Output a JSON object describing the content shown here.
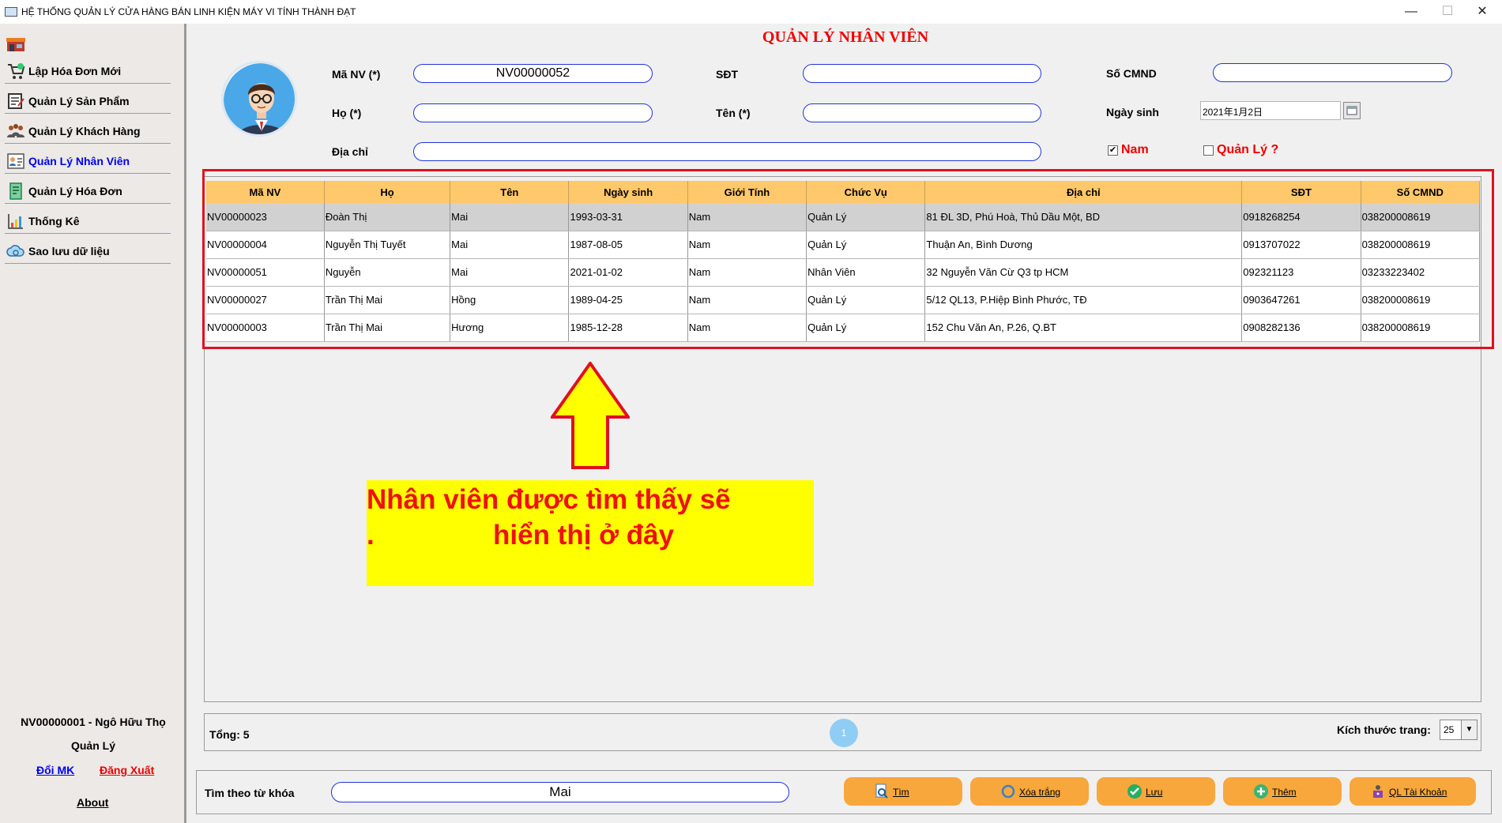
{
  "window": {
    "title": "HỆ THỐNG QUẢN LÝ CỬA HÀNG BÁN LINH KIỆN MÁY VI TÍNH THÀNH ĐẠT",
    "min": "—",
    "max": "☐",
    "close": "✕"
  },
  "sidebar": {
    "items": [
      {
        "label": "Lập Hóa Đơn Mới",
        "icon": "cart-icon"
      },
      {
        "label": "Quản Lý Sản Phẩm",
        "icon": "product-icon"
      },
      {
        "label": "Quản Lý Khách Hàng",
        "icon": "customers-icon"
      },
      {
        "label": "Quản Lý Nhân Viên",
        "icon": "employee-icon"
      },
      {
        "label": "Quản Lý Hóa Đơn",
        "icon": "invoice-icon"
      },
      {
        "label": "Thống Kê",
        "icon": "chart-icon"
      },
      {
        "label": "Sao lưu dữ liệu",
        "icon": "backup-icon"
      }
    ],
    "active_index": 3,
    "user_name": "NV00000001 - Ngô Hữu  Thọ",
    "user_role": "Quản Lý",
    "change_password": "Đổi MK",
    "logout": "Đăng Xuất",
    "about": "About"
  },
  "page_title": "QUẢN LÝ NHÂN VIÊN",
  "form": {
    "ma_nv_label": "Mã NV (*)",
    "ma_nv_value": "NV00000052",
    "sdt_label": "SĐT",
    "sdt_value": "",
    "cmnd_label": "Số CMND",
    "cmnd_value": "",
    "ho_label": "Họ (*)",
    "ho_value": "",
    "ten_label": "Tên (*)",
    "ten_value": "",
    "ngay_sinh_label": "Ngày sinh",
    "ngay_sinh_value": "2021年1月2日",
    "dia_chi_label": "Địa chỉ",
    "dia_chi_value": "",
    "nam_label": "Nam",
    "nam_checked": "✔",
    "quan_ly_label": "Quản Lý ?",
    "quan_ly_checked": ""
  },
  "table": {
    "columns": [
      "Mã NV",
      "Họ",
      "Tên",
      "Ngày sinh",
      "Giới Tính",
      "Chức Vụ",
      "Địa chỉ",
      "SĐT",
      "Số CMND"
    ],
    "rows": [
      [
        "NV00000023",
        "Đoàn Thị",
        "Mai",
        "1993-03-31",
        "Nam",
        "Quản Lý",
        "81 ĐL 3D, Phú Hoà, Thủ Dầu Một, BD",
        "0918268254",
        "038200008619"
      ],
      [
        "NV00000004",
        "Nguyễn Thị Tuyết",
        "Mai",
        "1987-08-05",
        "Nam",
        "Quản Lý",
        "Thuận An, Bình Dương",
        "0913707022",
        "038200008619"
      ],
      [
        "NV00000051",
        "Nguyễn",
        "Mai",
        "2021-01-02",
        "Nam",
        "Nhân Viên",
        "32 Nguyễn Văn Cừ Q3 tp HCM",
        "092321123",
        "03233223402"
      ],
      [
        "NV00000027",
        "Trần Thị Mai",
        "Hồng",
        "1989-04-25",
        "Nam",
        "Quản Lý",
        "5/12 QL13, P.Hiệp Bình Phước, TĐ",
        "0903647261",
        "038200008619"
      ],
      [
        "NV00000003",
        "Trần Thị Mai",
        "Hương",
        "1985-12-28",
        "Nam",
        "Quản Lý",
        "152 Chu Văn An, P.26, Q.BT",
        "0908282136",
        "038200008619"
      ]
    ],
    "selected_row": 0
  },
  "annotation": {
    "line1": "Nhân viên được tìm thấy sẽ",
    "dot": ".",
    "line2": "hiển thị ở đây"
  },
  "pager": {
    "total": "Tổng: 5",
    "current_page": "1",
    "size_label": "Kích thước trang:",
    "size_value": "25"
  },
  "search": {
    "label": "Tìm theo từ khóa",
    "value": "Mai"
  },
  "buttons": {
    "tim": "Tìm",
    "xoa_trang": "Xóa trắng",
    "luu": "Lưu",
    "them": "Thêm",
    "ql_tai_khoan": "QL Tài Khoản"
  },
  "colors": {
    "header": "#ffc86a",
    "title_red": "#ee0000",
    "button": "#f7a73c",
    "annotation_bg": "#ffff00",
    "frame_red": "#e0101e"
  }
}
